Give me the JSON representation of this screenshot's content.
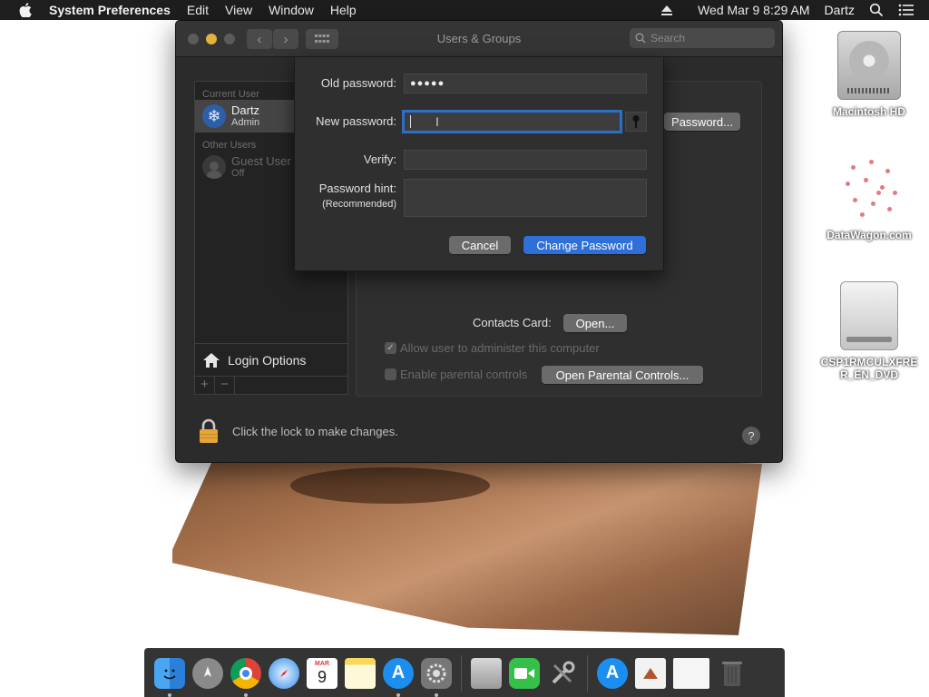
{
  "menubar": {
    "app_name": "System Preferences",
    "menus": [
      "Edit",
      "View",
      "Window",
      "Help"
    ],
    "datetime": "Wed Mar 9  8:29 AM",
    "user": "Dartz"
  },
  "desktop": {
    "icons": [
      {
        "label": "Macintosh HD",
        "icon": "hard-drive-icon"
      },
      {
        "label": "DataWagon.com",
        "icon": "network-graph-icon"
      },
      {
        "label": "CSP1RMCULXFRER_EN_DVD",
        "icon": "dvd-drive-icon"
      }
    ]
  },
  "window": {
    "title": "Users & Groups",
    "search_placeholder": "Search",
    "sidebar": {
      "current_user_header": "Current User",
      "current_user": {
        "name": "Dartz",
        "role": "Admin"
      },
      "other_users_header": "Other Users",
      "other_users": [
        {
          "name": "Guest User",
          "status": "Off"
        }
      ],
      "login_options": "Login Options",
      "add_label": "+",
      "remove_label": "−"
    },
    "content": {
      "change_password_button": "Password...",
      "contacts_card_label": "Contacts Card:",
      "contacts_open_button": "Open...",
      "allow_admin_label": "Allow user to administer this computer",
      "allow_admin_checked": true,
      "parental_label": "Enable parental controls",
      "parental_checked": false,
      "open_parental_button": "Open Parental Controls..."
    },
    "lock_text": "Click the lock to make changes.",
    "help_label": "?"
  },
  "sheet": {
    "old_password_label": "Old password:",
    "old_password_value": "●●●●●",
    "new_password_label": "New password:",
    "new_password_value": "",
    "verify_label": "Verify:",
    "verify_value": "",
    "hint_label": "Password hint:",
    "hint_sublabel": "(Recommended)",
    "hint_value": "",
    "cancel_button": "Cancel",
    "change_button": "Change Password"
  },
  "dock": {
    "calendar_month": "MAR",
    "calendar_day": "9",
    "apps": [
      "Finder",
      "Launchpad",
      "Chrome",
      "Safari",
      "Calendar",
      "Notes",
      "App Store",
      "System Preferences",
      "Archive Utility",
      "FaceTime",
      "Utilities",
      "App Store Downloads",
      "Documents",
      "Screen",
      "Trash"
    ]
  },
  "colors": {
    "accent": "#2e6fd8",
    "window_bg": "#2b2b2b",
    "lock_color": "#e6a53a"
  }
}
